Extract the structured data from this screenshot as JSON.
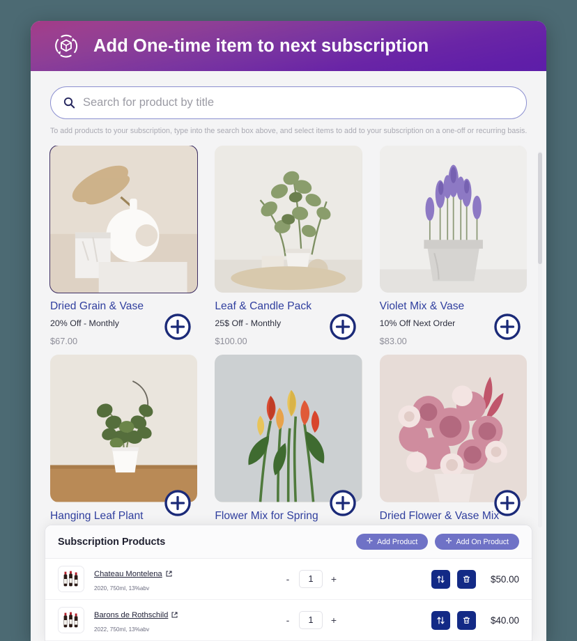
{
  "background_color": "#4c6a73",
  "header": {
    "title": "Add One-time item to next subscription",
    "icon": "subscription-cube-icon",
    "gradient_from": "#a33b86",
    "gradient_to": "#5d1da9",
    "text_color": "#ffffff"
  },
  "search": {
    "placeholder": "Search for product by title",
    "value": "",
    "icon": "search-icon",
    "border_color": "#8b8fd0",
    "helper_text": "To add products to your subscription, type into the search box above, and select items to add to your subscription on a one-off or recurring basis."
  },
  "products": {
    "add_icon": "plus-circle-icon",
    "selected_index": 0,
    "selected_border_color": "#3e2f63",
    "title_color": "#2f3e9e",
    "items": [
      {
        "title": "Dried Grain & Vase",
        "offer": "20% Off - Monthly",
        "price": "$67.00",
        "image": "dried-pampas-grass-in-white-donut-vase",
        "selected": true
      },
      {
        "title": "Leaf & Candle Pack",
        "offer": "25$ Off - Monthly",
        "price": "$100.00",
        "image": "eucalyptus-leaves-with-candle-and-pot",
        "selected": false
      },
      {
        "title": "Violet Mix & Vase",
        "offer": "10% Off Next Order",
        "price": "$83.00",
        "image": "lavender-violet-flowers-in-concrete-pot",
        "selected": false
      },
      {
        "title": "Hanging Leaf Plant",
        "offer": "",
        "price": "",
        "image": "hanging-leaf-plant-in-white-pot",
        "selected": false
      },
      {
        "title": "Flower Mix for Spring",
        "offer": "",
        "price": "",
        "image": "red-and-yellow-tulip-bouquet",
        "selected": false
      },
      {
        "title": "Dried Flower & Vase Mix",
        "offer": "",
        "price": "",
        "image": "pink-dried-flower-arrangement",
        "selected": false
      }
    ]
  },
  "subscription_panel": {
    "title": "Subscription Products",
    "buttons": [
      {
        "label": "Add Product",
        "icon": "plus-icon",
        "color": "#6f72c6"
      },
      {
        "label": "Add On Product",
        "icon": "plus-icon",
        "color": "#6f72c6"
      }
    ],
    "row_action_color": "#132a86",
    "rows": [
      {
        "name": "Chateau Montelena",
        "link_icon": "external-link-icon",
        "meta": "2020, 750ml, 13%abv",
        "thumb": "three-wine-bottles-icon",
        "decrement": "-",
        "quantity": "1",
        "increment": "+",
        "swap_icon": "swap-vertical-icon",
        "delete_icon": "trash-icon",
        "price": "$50.00"
      },
      {
        "name": "Barons de Rothschild",
        "link_icon": "external-link-icon",
        "meta": "2022, 750ml, 13%abv",
        "thumb": "three-wine-bottles-icon",
        "decrement": "-",
        "quantity": "1",
        "increment": "+",
        "swap_icon": "swap-vertical-icon",
        "delete_icon": "trash-icon",
        "price": "$40.00"
      }
    ]
  }
}
